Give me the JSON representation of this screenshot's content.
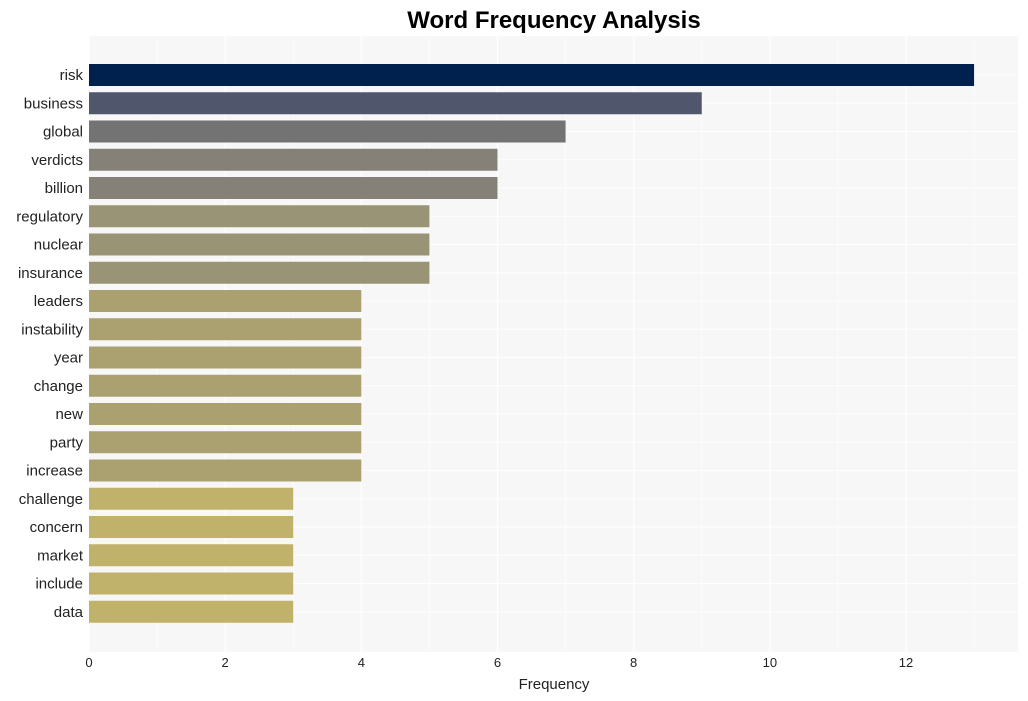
{
  "chart_data": {
    "type": "bar",
    "orientation": "horizontal",
    "title": "Word Frequency Analysis",
    "xlabel": "Frequency",
    "ylabel": "",
    "xlim": [
      0,
      13.6
    ],
    "xticks": [
      0,
      2,
      4,
      6,
      8,
      10,
      12
    ],
    "grid": true,
    "categories": [
      "risk",
      "business",
      "global",
      "verdicts",
      "billion",
      "regulatory",
      "nuclear",
      "insurance",
      "leaders",
      "instability",
      "year",
      "change",
      "new",
      "party",
      "increase",
      "challenge",
      "concern",
      "market",
      "include",
      "data"
    ],
    "values": [
      13,
      9,
      7,
      6,
      6,
      5,
      5,
      5,
      4,
      4,
      4,
      4,
      4,
      4,
      4,
      3,
      3,
      3,
      3,
      3
    ],
    "colors": [
      "#00214d",
      "#50566b",
      "#737373",
      "#858179",
      "#858179",
      "#9a9477",
      "#9a9477",
      "#9a9477",
      "#aaa070",
      "#aaa070",
      "#aaa070",
      "#aaa070",
      "#aaa070",
      "#aaa070",
      "#aaa070",
      "#c0b26a",
      "#c0b26a",
      "#c0b26a",
      "#c0b26a",
      "#c0b26a"
    ],
    "background": "#f7f7f7",
    "grid_color": "#ffffff"
  }
}
